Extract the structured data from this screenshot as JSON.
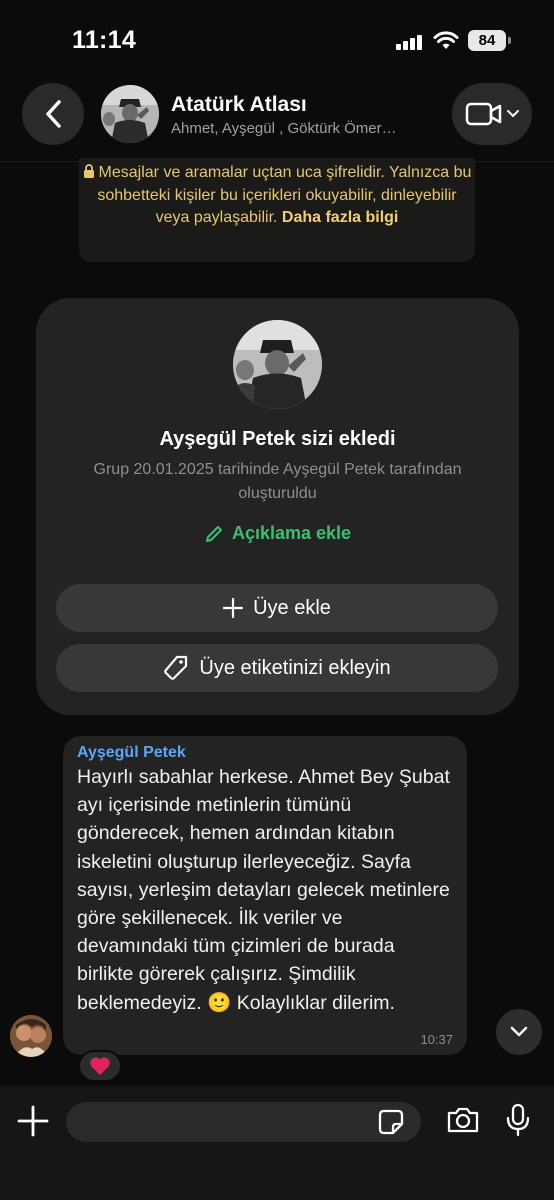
{
  "status_bar": {
    "time": "11:14",
    "battery": "84"
  },
  "header": {
    "title": "Atatürk Atlası",
    "subtitle": "Ahmet, Ayşegül , Göktürk Ömer…"
  },
  "notice": {
    "text": "Mesajlar ve aramalar uçtan uca şifrelidir. Yalnızca bu sohbetteki kişiler bu içerikleri okuyabilir, dinleyebilir veya paylaşabilir.",
    "link": "Daha fazla bilgi"
  },
  "group_card": {
    "title": "Ayşegül  Petek sizi ekledi",
    "subtitle": "Grup 20.01.2025 tarihinde Ayşegül  Petek tarafından oluşturuldu",
    "description_link": "Açıklama ekle",
    "add_member": "Üye ekle",
    "add_tag": "Üye etiketinizi ekleyin"
  },
  "message": {
    "sender": "Ayşegül  Petek",
    "text": "Hayırlı sabahlar herkese. Ahmet Bey Şubat ayı içerisinde metinlerin tümünü gönderecek, hemen ardından kitabın iskeletini oluşturup ilerleyeceğiz. Sayfa sayısı, yerleşim detayları gelecek metinlere göre şekillenecek. İlk veriler ve devamındaki tüm çizimleri de burada birlikte görerek çalışırız. Şimdilik beklemedeyiz. 🙂 Kolaylıklar dilerim.",
    "time": "10:37",
    "reaction": "❤️"
  },
  "composer": {
    "placeholder": ""
  },
  "colors": {
    "accent_green": "#38c172",
    "sender_blue": "#59a8f5",
    "notice_yellow": "#e8c66a",
    "reaction_red": "#e0245e"
  },
  "icons": [
    "back-chevron-icon",
    "video-camera-icon",
    "lock-icon",
    "pencil-icon",
    "plus-icon",
    "tag-icon",
    "chevron-down-icon",
    "sticker-icon",
    "camera-icon",
    "microphone-icon"
  ]
}
